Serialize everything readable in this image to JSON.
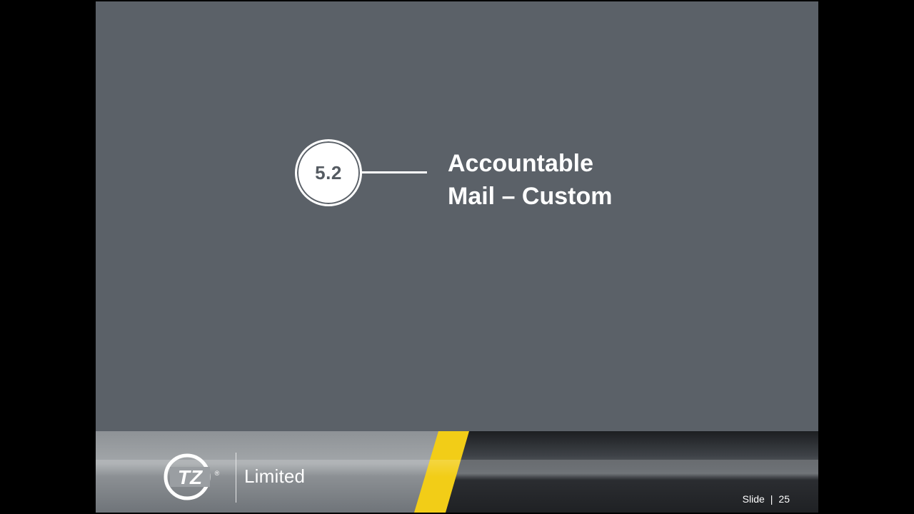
{
  "section": {
    "number": "5.2",
    "title_line1": "Accountable",
    "title_line2": "Mail – Custom"
  },
  "footer": {
    "logo_text": "TZ",
    "logo_mark": "®",
    "brand": "Limited",
    "slide_label": "Slide",
    "separator": "|",
    "slide_number": "25"
  },
  "colors": {
    "background": "#5b6168",
    "accent_yellow": "#f2cd17",
    "text": "#ffffff"
  }
}
